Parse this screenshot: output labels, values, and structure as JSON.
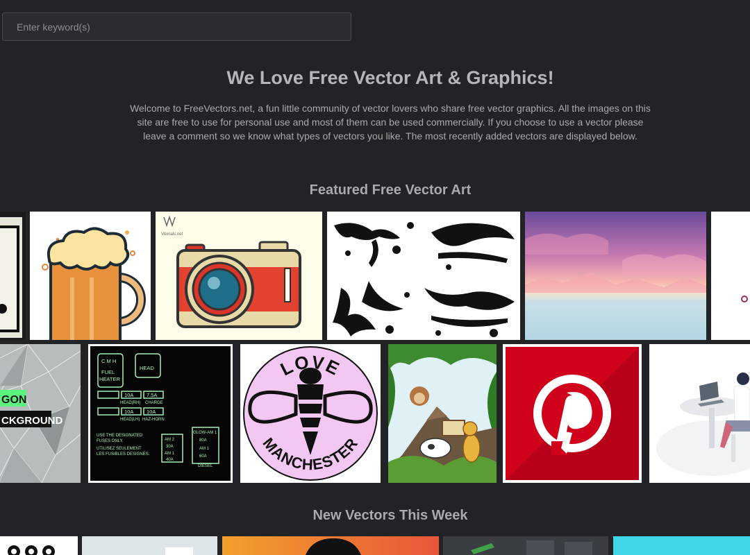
{
  "search": {
    "placeholder": "Enter keyword(s)"
  },
  "hero": {
    "title": "We Love Free Vector Art & Graphics!",
    "intro": "Welcome to FreeVectors.net, a fun little community of vector lovers who share free vector graphics. All the images on this site are free to use for personal use and most of them can be used commercially. If you choose to use a vector please leave a comment so we know what types of vectors you like. The most recently added vectors are displayed below."
  },
  "featured": {
    "heading": "Featured Free Vector Art",
    "camera_watermark": "Vitorials.net",
    "polygon_words": [
      "GON",
      "CKGROUND"
    ],
    "fuse_box": {
      "left_box": [
        "C M H",
        "·",
        "FUEL",
        "HEATER"
      ],
      "right_box": "HEAD",
      "cells": [
        "10A",
        "7.5A",
        "10A",
        "10A"
      ],
      "labels": [
        "HEAD(RH)",
        "CHARGE",
        "HEAD(LH)",
        "HAZ-HORN"
      ],
      "notice": [
        "USE THE DESIGNATED",
        "FUSES ONLY.",
        "UTILISEZ  SEULEMENT",
        "LES FUSIBLES DESIGNES."
      ],
      "am_labels": [
        "AM 2",
        "30A",
        "AM 1",
        "40A"
      ],
      "glow_labels": [
        "GLOW-AM 1",
        "80A",
        "AM 1",
        "60A",
        "DIESEL"
      ]
    },
    "bee": {
      "top": "LOVE",
      "bottom": "MANCHESTER"
    }
  },
  "new_week": {
    "heading": "New Vectors This Week"
  }
}
